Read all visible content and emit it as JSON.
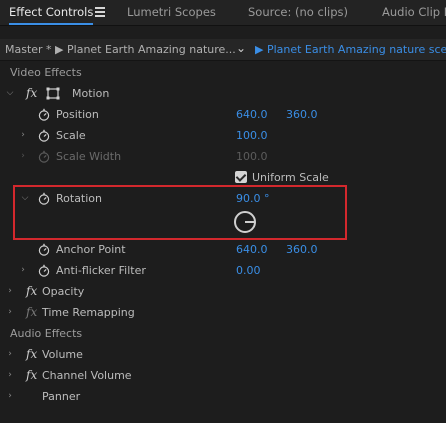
{
  "tabs": [
    {
      "label": "Effect Controls",
      "active": true
    },
    {
      "label": "Lumetri Scopes"
    },
    {
      "label": "Source: (no clips)"
    },
    {
      "label": "Audio Clip M"
    }
  ],
  "clip_header": {
    "source": "Master * ▶ Planet Earth  Amazing nature...",
    "sequence": "▶ Planet Earth  Amazing nature scene"
  },
  "sections": {
    "video": "Video Effects",
    "audio": "Audio Effects"
  },
  "motion": {
    "label": "Motion",
    "position": {
      "label": "Position",
      "x": "640.0",
      "y": "360.0"
    },
    "scale": {
      "label": "Scale",
      "value": "100.0"
    },
    "scale_width": {
      "label": "Scale Width",
      "value": "100.0"
    },
    "uniform_scale": {
      "label": "Uniform Scale",
      "checked": true
    },
    "rotation": {
      "label": "Rotation",
      "value": "90.0 °"
    },
    "anchor_point": {
      "label": "Anchor Point",
      "x": "640.0",
      "y": "360.0"
    },
    "anti_flicker": {
      "label": "Anti-flicker Filter",
      "value": "0.00"
    }
  },
  "effects": {
    "opacity": "Opacity",
    "time_remapping": "Time Remapping",
    "volume": "Volume",
    "channel_volume": "Channel Volume",
    "panner": "Panner"
  },
  "icons": {
    "fx": "fx",
    "twisty_open": "⌵",
    "twisty_closed": "›",
    "chevron_down": "⌄"
  },
  "colors": {
    "accent": "#3a8ee6",
    "highlight_box": "#d3282d"
  }
}
